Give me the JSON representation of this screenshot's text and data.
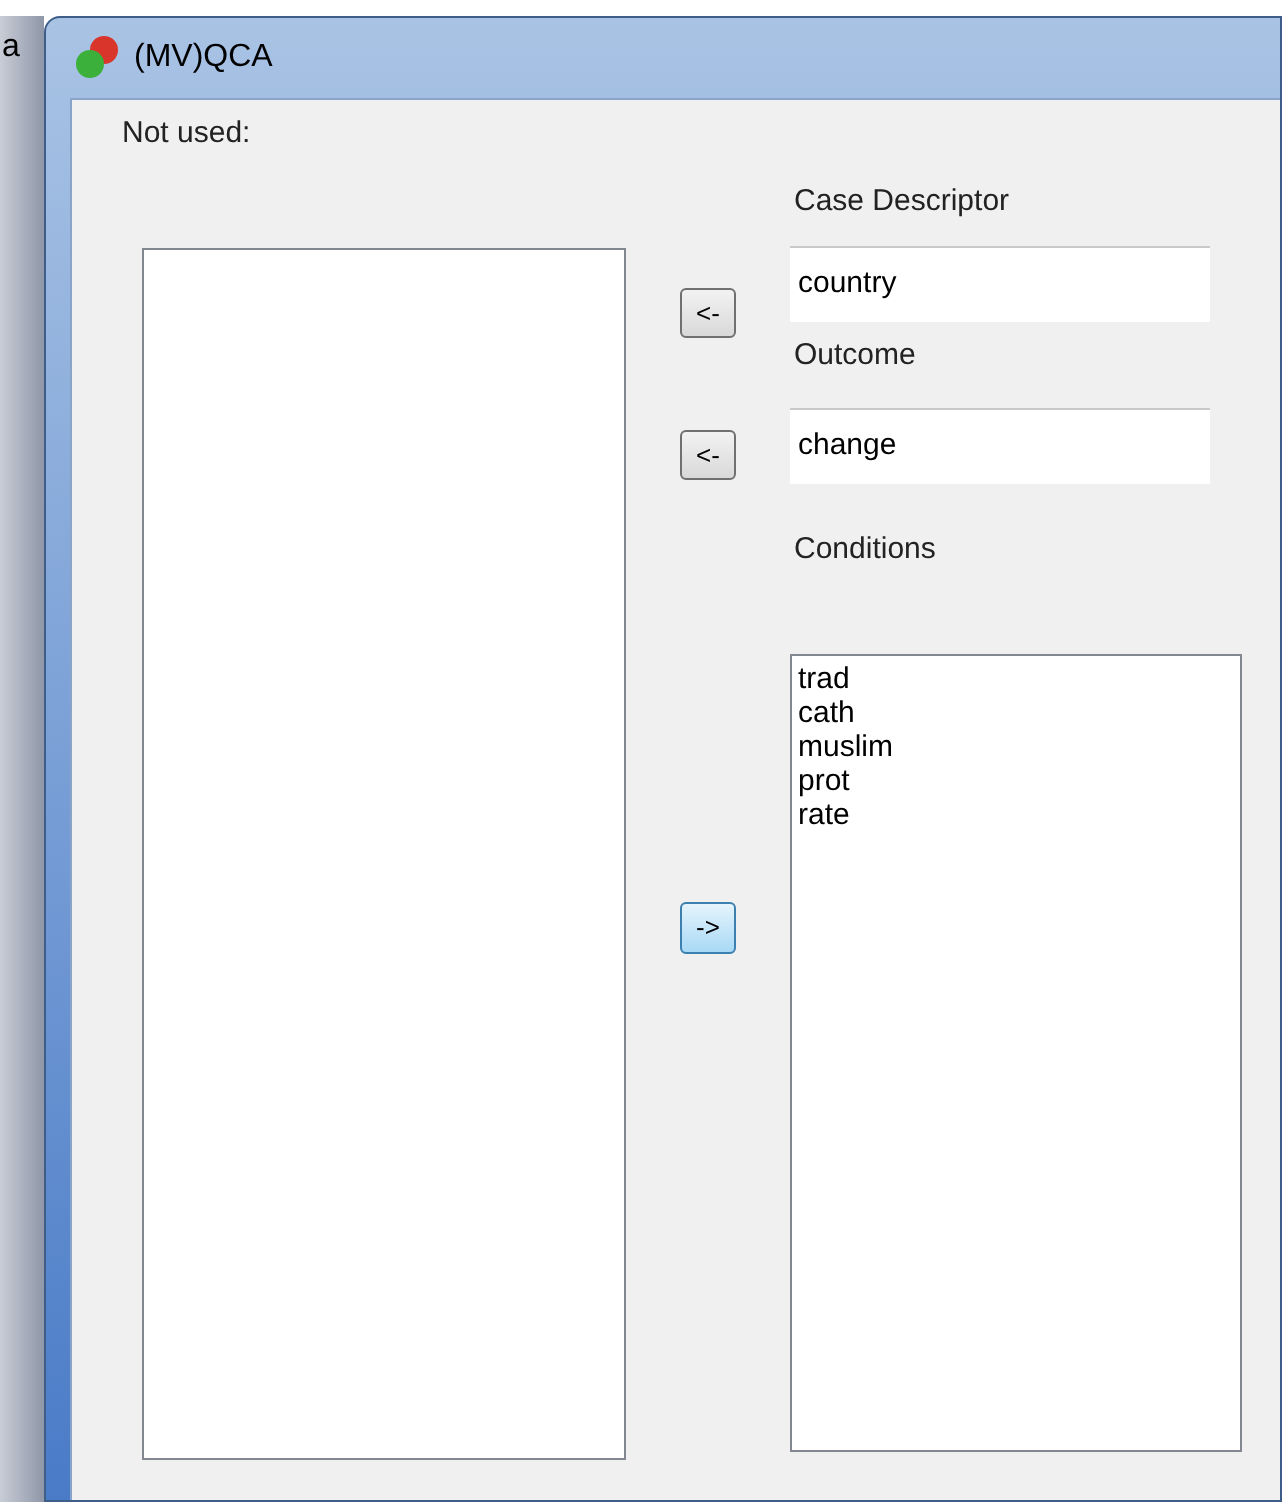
{
  "background_window": {
    "text": "a"
  },
  "window": {
    "title": "(MV)QCA"
  },
  "not_used": {
    "label": "Not used:"
  },
  "case_descriptor": {
    "label": "Case Descriptor",
    "value": "country",
    "button": "<-"
  },
  "outcome": {
    "label": "Outcome",
    "value": "change",
    "button": "<-"
  },
  "conditions": {
    "label": "Conditions",
    "button": "->",
    "button_focused": true,
    "items": [
      {
        "label": "trad"
      },
      {
        "label": "cath"
      },
      {
        "label": "muslim"
      },
      {
        "label": "prot"
      },
      {
        "label": "rate"
      }
    ]
  }
}
